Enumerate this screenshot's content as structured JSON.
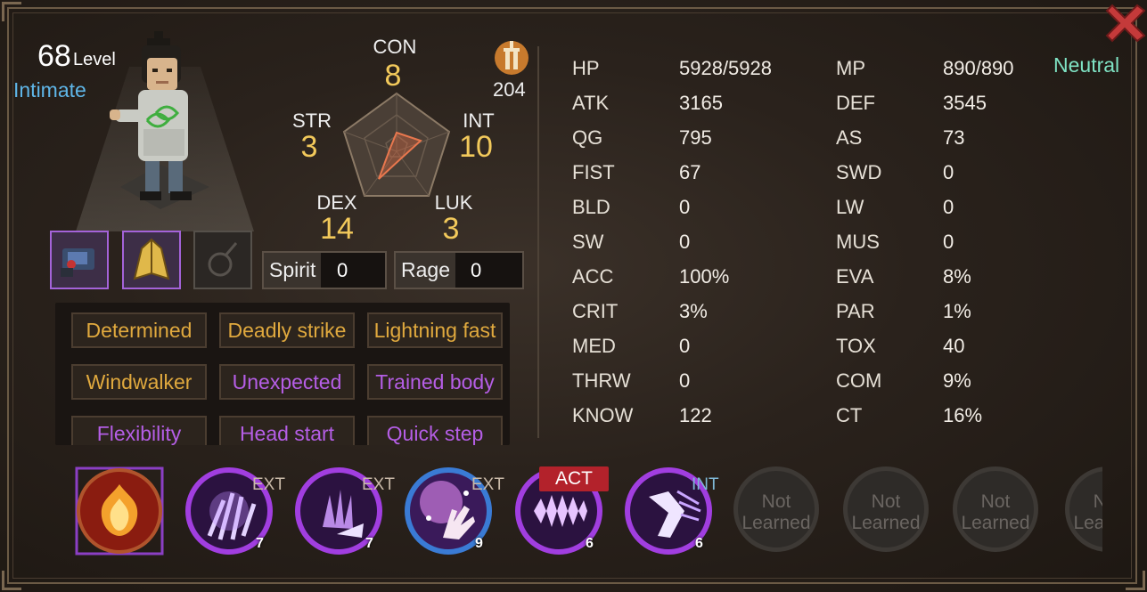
{
  "character": {
    "level": "68",
    "level_label": "Level",
    "relation": "Intimate",
    "alignment": "Neutral",
    "fame": "204"
  },
  "attributes": {
    "con": {
      "name": "CON",
      "value": "8"
    },
    "str": {
      "name": "STR",
      "value": "3"
    },
    "int": {
      "name": "INT",
      "value": "10"
    },
    "dex": {
      "name": "DEX",
      "value": "14"
    },
    "luk": {
      "name": "LUK",
      "value": "3"
    }
  },
  "meters": {
    "spirit": {
      "label": "Spirit",
      "value": "0"
    },
    "rage": {
      "label": "Rage",
      "value": "0"
    }
  },
  "traits": [
    {
      "label": "Determined",
      "color": "#e0a93e"
    },
    {
      "label": "Deadly strike",
      "color": "#e0a93e"
    },
    {
      "label": "Lightning fast",
      "color": "#e0a93e"
    },
    {
      "label": "Windwalker",
      "color": "#e0a93e"
    },
    {
      "label": "Unexpected",
      "color": "#b55ee6"
    },
    {
      "label": "Trained body",
      "color": "#b55ee6"
    },
    {
      "label": "Flexibility",
      "color": "#b55ee6"
    },
    {
      "label": "Head start",
      "color": "#b55ee6"
    },
    {
      "label": "Quick step",
      "color": "#b55ee6"
    }
  ],
  "stats_left": [
    {
      "name": "HP",
      "value": "5928/5928"
    },
    {
      "name": "ATK",
      "value": "3165"
    },
    {
      "name": "QG",
      "value": "795"
    },
    {
      "name": "FIST",
      "value": "67"
    },
    {
      "name": "BLD",
      "value": "0"
    },
    {
      "name": "SW",
      "value": "0"
    },
    {
      "name": "ACC",
      "value": "100%"
    },
    {
      "name": "CRIT",
      "value": "3%"
    },
    {
      "name": "MED",
      "value": "0"
    },
    {
      "name": "THRW",
      "value": "0"
    },
    {
      "name": "KNOW",
      "value": "122"
    }
  ],
  "stats_right": [
    {
      "name": "MP",
      "value": "890/890"
    },
    {
      "name": "DEF",
      "value": "3545"
    },
    {
      "name": "AS",
      "value": "73"
    },
    {
      "name": "SWD",
      "value": "0"
    },
    {
      "name": "LW",
      "value": "0"
    },
    {
      "name": "MUS",
      "value": "0"
    },
    {
      "name": "EVA",
      "value": "8%"
    },
    {
      "name": "PAR",
      "value": "1%"
    },
    {
      "name": "TOX",
      "value": "40"
    },
    {
      "name": "COM",
      "value": "9%"
    },
    {
      "name": "CT",
      "value": "16%"
    }
  ],
  "skills": [
    {
      "icon": "flame-lotus-icon",
      "badge": "",
      "level": ""
    },
    {
      "icon": "claw-strike-icon",
      "badge": "EXT",
      "level": "7"
    },
    {
      "icon": "palm-burst-icon",
      "badge": "EXT",
      "level": "7"
    },
    {
      "icon": "sparkling-palm-icon",
      "badge": "EXT",
      "level": "9"
    },
    {
      "icon": "spiked-wave-icon",
      "badge": "ACT",
      "level": "6"
    },
    {
      "icon": "crescent-kick-icon",
      "badge": "INT",
      "level": "6"
    }
  ],
  "not_learned_label": "Not Learned",
  "colors": {
    "attr_value": "#f2c95b",
    "relation": "#5fb6e8",
    "alignment": "#7fe3c4",
    "act_badge": "#b3222b",
    "skill_ring": "#a13ee0"
  }
}
